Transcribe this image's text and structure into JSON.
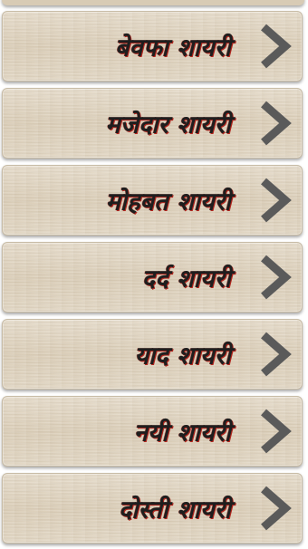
{
  "categories": [
    {
      "label": "बेवफा शायरी",
      "icon": "chevron-right-icon"
    },
    {
      "label": "मजेदार शायरी",
      "icon": "chevron-right-icon"
    },
    {
      "label": "मोहबत शायरी",
      "icon": "chevron-right-icon"
    },
    {
      "label": "दर्द शायरी",
      "icon": "chevron-right-icon"
    },
    {
      "label": "याद शायरी",
      "icon": "chevron-right-icon"
    },
    {
      "label": "नयी शायरी",
      "icon": "chevron-right-icon"
    },
    {
      "label": "दोस्ती शायरी",
      "icon": "chevron-right-icon"
    }
  ],
  "colors": {
    "label_text": "#1e1e1e",
    "label_shadow": "#b3261e",
    "chevron": "#5a5a5a",
    "card_background": "#e1d6c3"
  }
}
